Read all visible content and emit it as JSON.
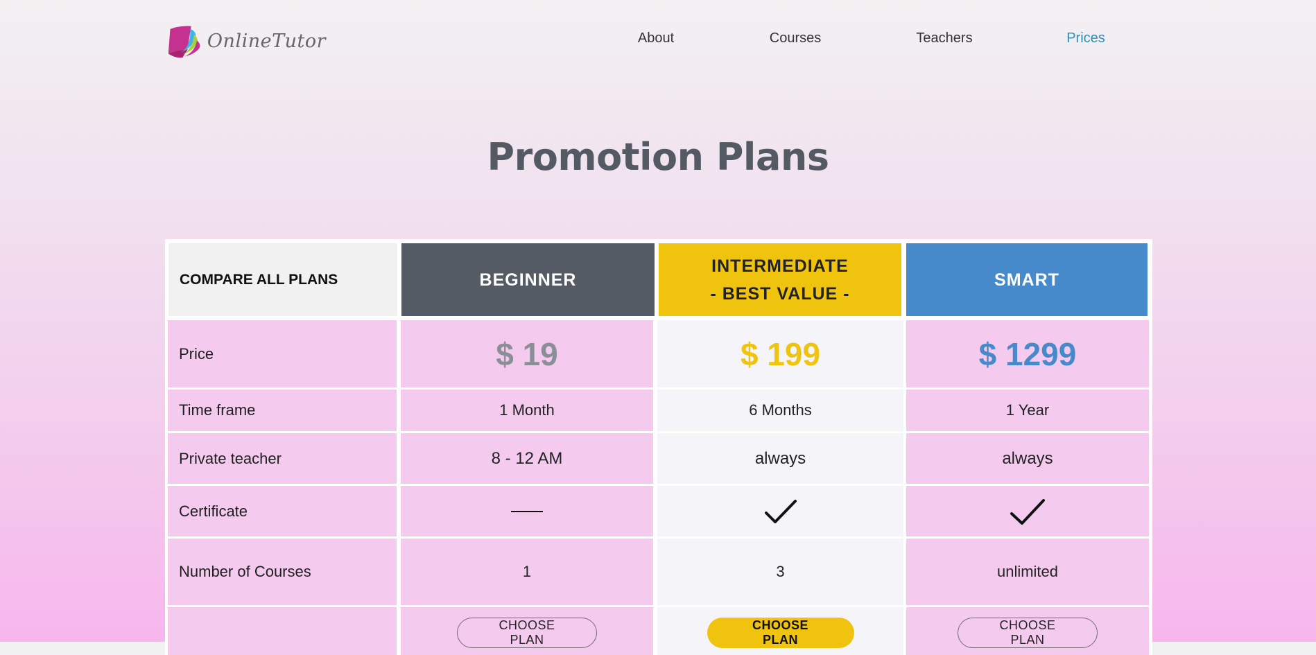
{
  "header": {
    "logo_text": "OnlineTutor",
    "nav": [
      {
        "label": "About",
        "active": false
      },
      {
        "label": "Courses",
        "active": false
      },
      {
        "label": "Teachers",
        "active": false
      },
      {
        "label": "Prices",
        "active": true
      }
    ]
  },
  "page_title": "Promotion Plans",
  "table": {
    "compare_label": "COMPARE ALL PLANS",
    "plans": [
      {
        "name_line1": "BEGINNER",
        "name_line2": "",
        "price": "$ 19",
        "time_frame": "1 Month",
        "private_teacher": "8 - 12 AM",
        "certificate": "dash-icon",
        "courses": "1",
        "button": "CHOOSE PLAN"
      },
      {
        "name_line1": "INTERMEDIATE",
        "name_line2": "- BEST VALUE -",
        "price": "$ 199",
        "time_frame": "6 Months",
        "private_teacher": "always",
        "certificate": "checkmark-icon",
        "courses": "3",
        "button": "CHOOSE PLAN"
      },
      {
        "name_line1": "SMART",
        "name_line2": "",
        "price": "$ 1299",
        "time_frame": "1 Year",
        "private_teacher": "always",
        "certificate": "checkmark-icon",
        "courses": "unlimited",
        "button": "CHOOSE PLAN"
      }
    ],
    "row_labels": {
      "price": "Price",
      "time_frame": "Time frame",
      "private_teacher": "Private teacher",
      "certificate": "Certificate",
      "courses": "Number of Courses"
    }
  },
  "colors": {
    "beginner": "#555b65",
    "intermediate": "#f0c30f",
    "smart": "#478acb",
    "nav_active": "#2e8fbb"
  }
}
